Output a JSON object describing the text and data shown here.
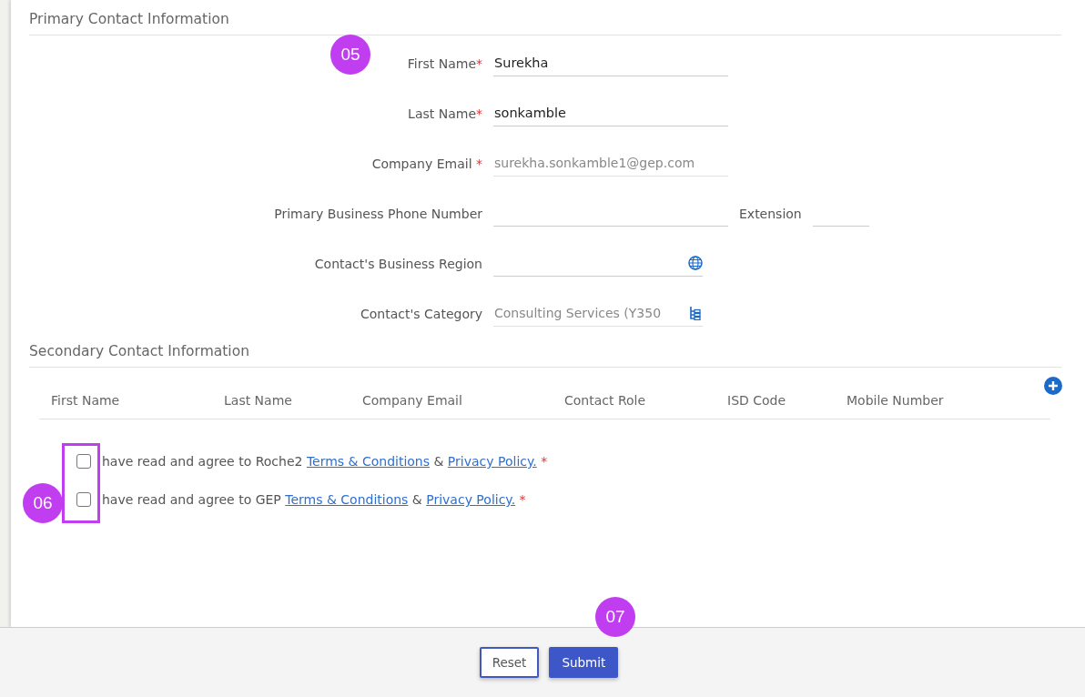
{
  "primary": {
    "title": "Primary Contact Information",
    "fields": [
      {
        "label": "First Name",
        "required_mark": "*",
        "value": "Surekha",
        "disabled": false,
        "kind": "text"
      },
      {
        "label": "Last Name",
        "required_mark": "*",
        "value": "sonkamble",
        "disabled": false,
        "kind": "text"
      },
      {
        "label": "Company Email",
        "required_mark": "*",
        "value": "surekha.sonkamble1@gep.com",
        "disabled": true,
        "kind": "text"
      },
      {
        "label": "Primary Business Phone Number",
        "disabled": false,
        "kind": "phone",
        "extension": "Extension"
      },
      {
        "label": "Contact's Business Region",
        "disabled": false,
        "kind": "region"
      },
      {
        "label": "Contact's Category",
        "value": "Consulting Services (Y350",
        "disabled": true,
        "kind": "category"
      }
    ]
  },
  "secondary": {
    "title": "Secondary Contact Information",
    "columns": [
      "First Name",
      "Last Name",
      "Company Email",
      "Contact Role",
      "ISD Code",
      "Mobile Number"
    ]
  },
  "agreements": [
    {
      "text": "have read and agree to Roche2",
      "terms": "Terms & Conditions",
      "joiner": "&",
      "privacy": "Privacy Policy.",
      "required_mark": "*",
      "checked": false
    },
    {
      "text": "have read and agree to GEP",
      "terms": "Terms & Conditions",
      "joiner": "&",
      "privacy": "Privacy Policy.",
      "required_mark": "*",
      "checked": false
    }
  ],
  "buttons": [
    {
      "label": "Reset",
      "kind": "outline"
    },
    {
      "label": "Submit",
      "kind": "primary"
    }
  ],
  "annotations": [
    {
      "label": "05"
    },
    {
      "label": "06"
    },
    {
      "label": "07"
    }
  ]
}
